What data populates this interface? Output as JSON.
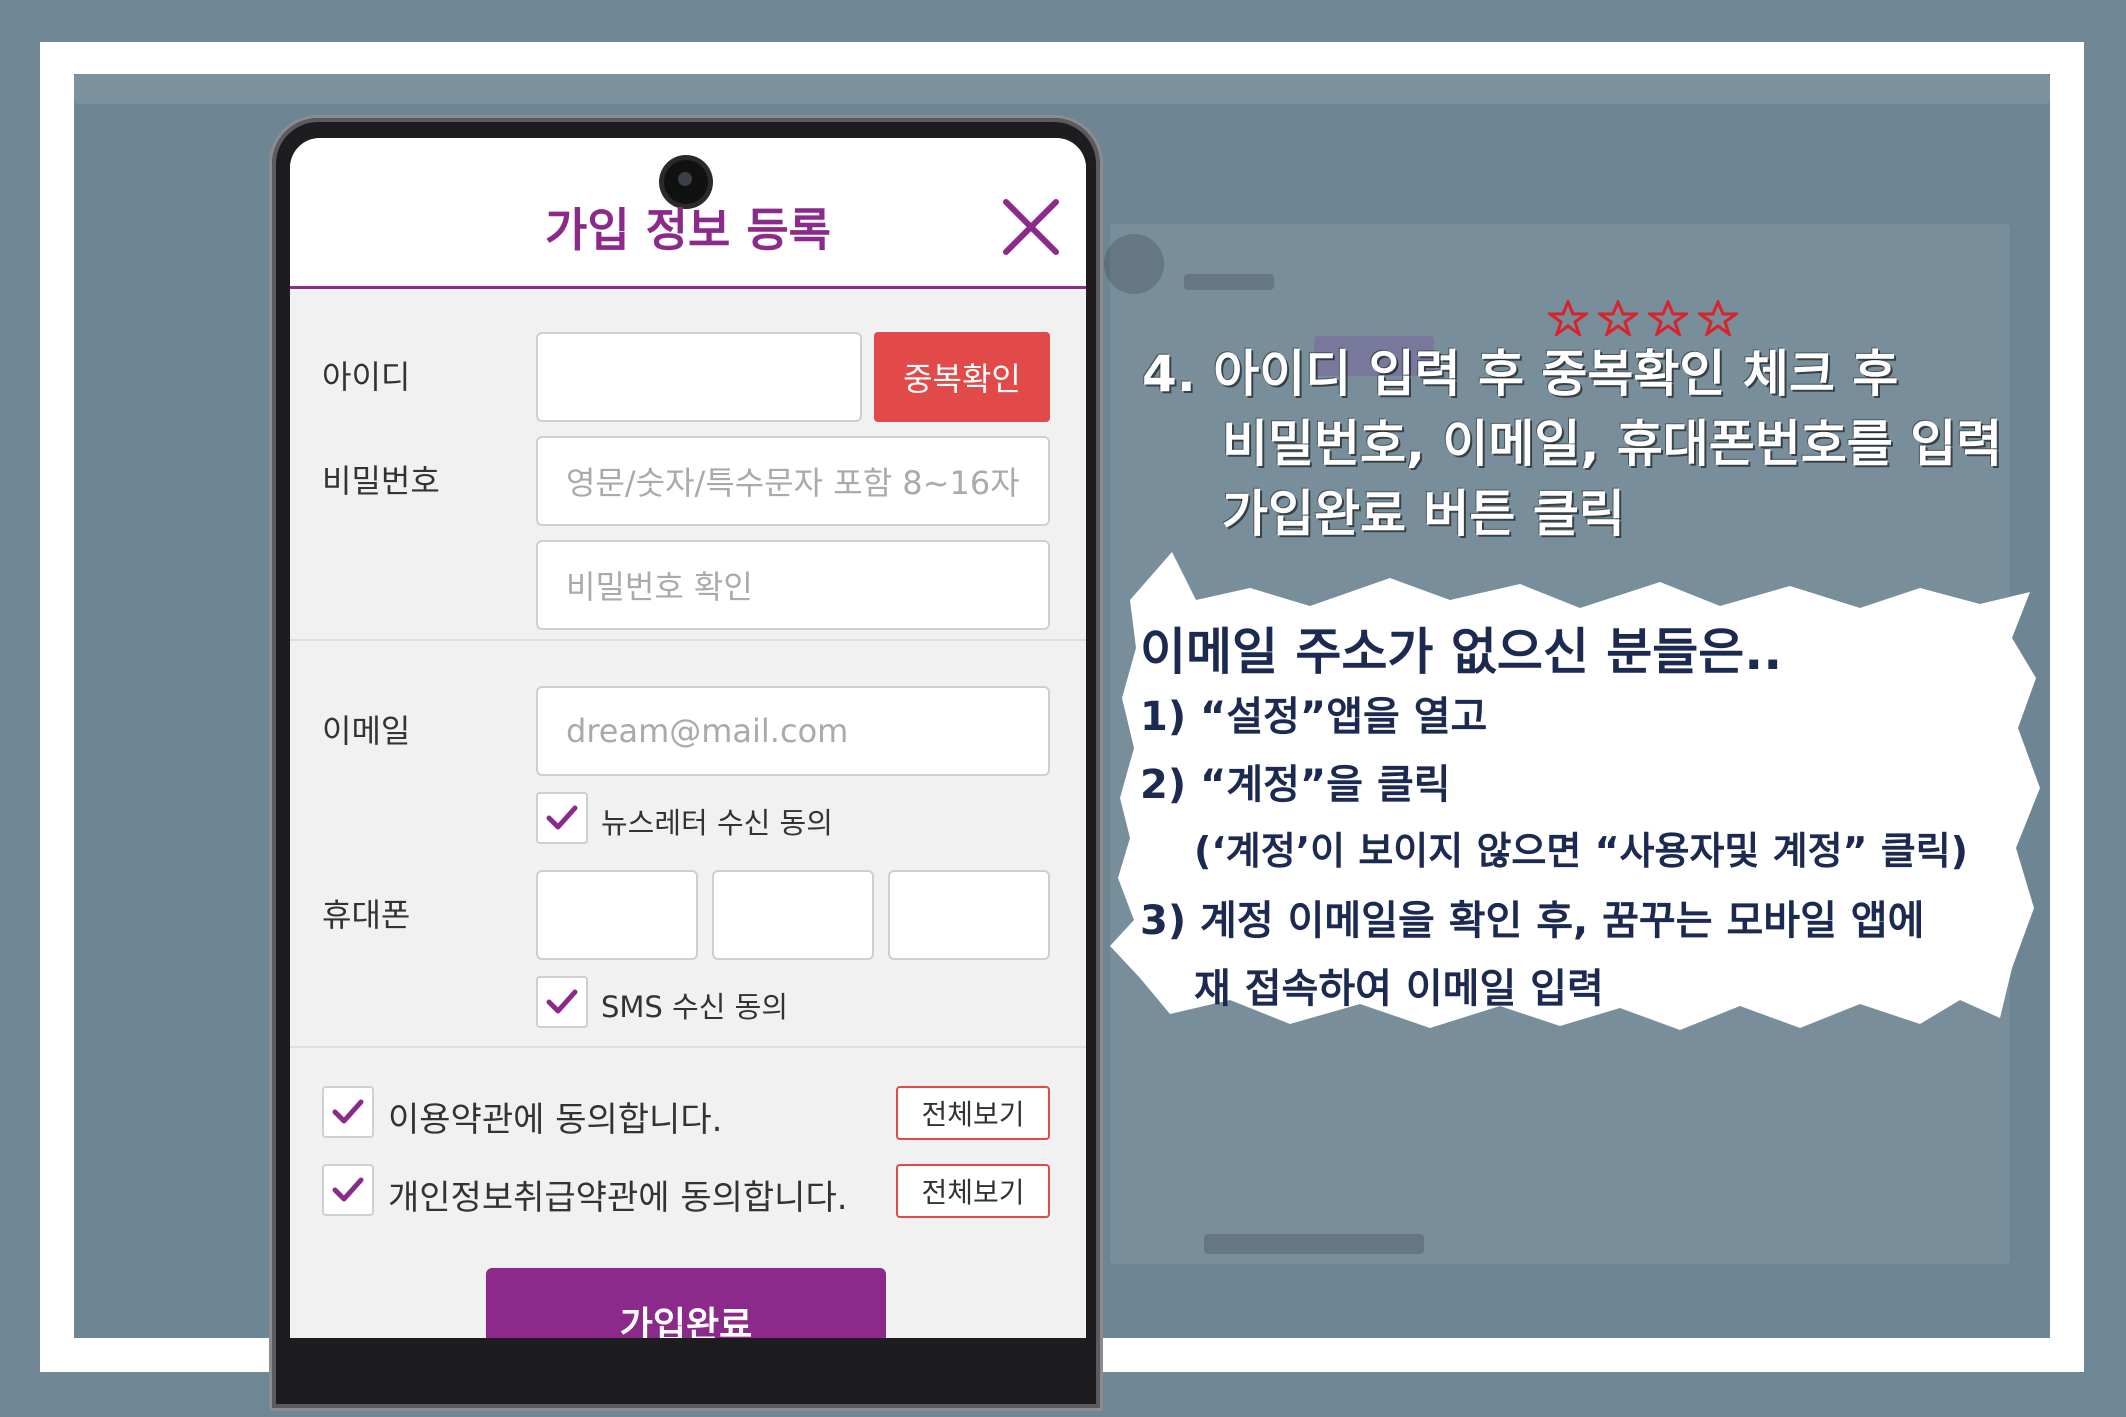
{
  "form": {
    "title": "가입 정보 등록",
    "id_label": "아이디",
    "dup_check_label": "중복확인",
    "password_label": "비밀번호",
    "password_placeholder": "영문/숫자/특수문자 포함  8~16자",
    "password_confirm_placeholder": "비밀번호 확인",
    "email_label": "이메일",
    "email_placeholder": "dream@mail.com",
    "newsletter_label": "뉴스레터 수신 동의",
    "phone_label": "휴대폰",
    "sms_label": "SMS 수신 동의",
    "terms_label": "이용약관에 동의합니다.",
    "privacy_label": "개인정보취급약관에 동의합니다.",
    "view_all_label": "전체보기",
    "submit_label": "가입완료",
    "colors": {
      "accent": "#8b2a8b",
      "button_red": "#e24a4a"
    }
  },
  "instructions": {
    "step_line1": "4. 아이디 입력 후 중복확인 체크 후",
    "step_line2": "비밀번호, 이메일, 휴대폰번호를 입력",
    "step_line3": "가입완료 버튼 클릭",
    "note_title": "이메일 주소가 없으신 분들은..",
    "note_line1": "1) “설정”앱을 열고",
    "note_line2": "2) “계정”을 클릭",
    "note_line3": "(‘계정’이 보이지 않으면 “사용자및 계정” 클릭)",
    "note_line4": "3) 계정 이메일을 확인 후, 꿈꾸는 모바일 앱에",
    "note_line5": "재 접속하여 이메일 입력",
    "colors": {
      "note_text": "#1c2a52",
      "star": "#d8232a"
    }
  }
}
